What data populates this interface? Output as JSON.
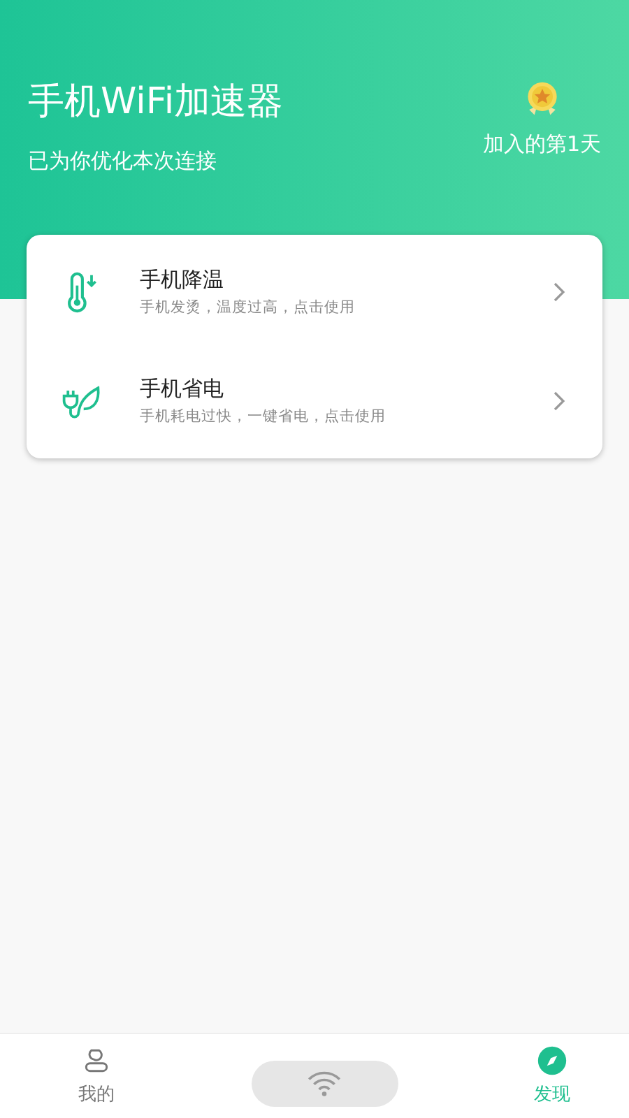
{
  "header": {
    "title": "手机WiFi加速器",
    "subtitle": "已为你优化本次连接",
    "days": "加入的第1天"
  },
  "features": [
    {
      "kind": "cool",
      "title": "手机降温",
      "desc": "手机发烫，温度过高，点击使用"
    },
    {
      "kind": "power",
      "title": "手机省电",
      "desc": "手机耗电过快，一键省电，点击使用"
    }
  ],
  "tabs": [
    {
      "kind": "profile",
      "label": "我的",
      "selected": false
    },
    {
      "kind": "wifi",
      "selected": false
    },
    {
      "kind": "discover",
      "label": "发现",
      "selected": true
    }
  ]
}
